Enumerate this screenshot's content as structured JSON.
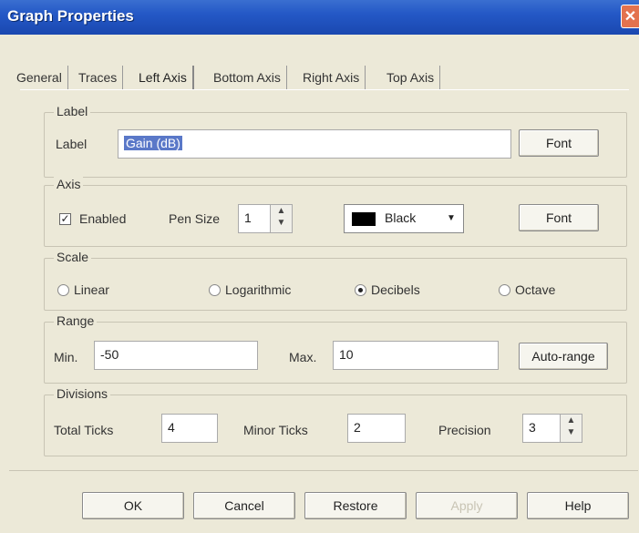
{
  "window": {
    "title": "Graph Properties",
    "close_glyph": "✕"
  },
  "tabs": [
    {
      "label": "General"
    },
    {
      "label": "Traces"
    },
    {
      "label": "Left Axis"
    },
    {
      "label": "Bottom Axis"
    },
    {
      "label": "Right Axis"
    },
    {
      "label": "Top Axis"
    }
  ],
  "label_group": {
    "title": "Label",
    "field_label": "Label",
    "value": "Gain (dB)",
    "font_button": "Font"
  },
  "axis_group": {
    "title": "Axis",
    "enabled_label": "Enabled",
    "enabled_checked": true,
    "check_glyph": "✓",
    "pen_size_label": "Pen Size",
    "pen_size_value": "1",
    "color_value": "Black",
    "color_swatch": "#000000",
    "font_button": "Font"
  },
  "scale_group": {
    "title": "Scale",
    "options": [
      "Linear",
      "Logarithmic",
      "Decibels",
      "Octave"
    ],
    "selected": "Decibels"
  },
  "range_group": {
    "title": "Range",
    "min_label": "Min.",
    "min_value": "-50",
    "max_label": "Max.",
    "max_value": "10",
    "autorange_button": "Auto-range"
  },
  "divisions_group": {
    "title": "Divisions",
    "total_ticks_label": "Total Ticks",
    "total_ticks_value": "4",
    "minor_ticks_label": "Minor Ticks",
    "minor_ticks_value": "2",
    "precision_label": "Precision",
    "precision_value": "3"
  },
  "footer": {
    "ok": "OK",
    "cancel": "Cancel",
    "restore": "Restore",
    "apply": "Apply",
    "help": "Help"
  },
  "spin_glyphs": {
    "up": "▲",
    "down": "▼",
    "dropdown": "▼"
  },
  "colors": {
    "titlebar": "#2458C6",
    "selection": "#5A78C8",
    "dialog_bg": "#ECE9D8"
  }
}
